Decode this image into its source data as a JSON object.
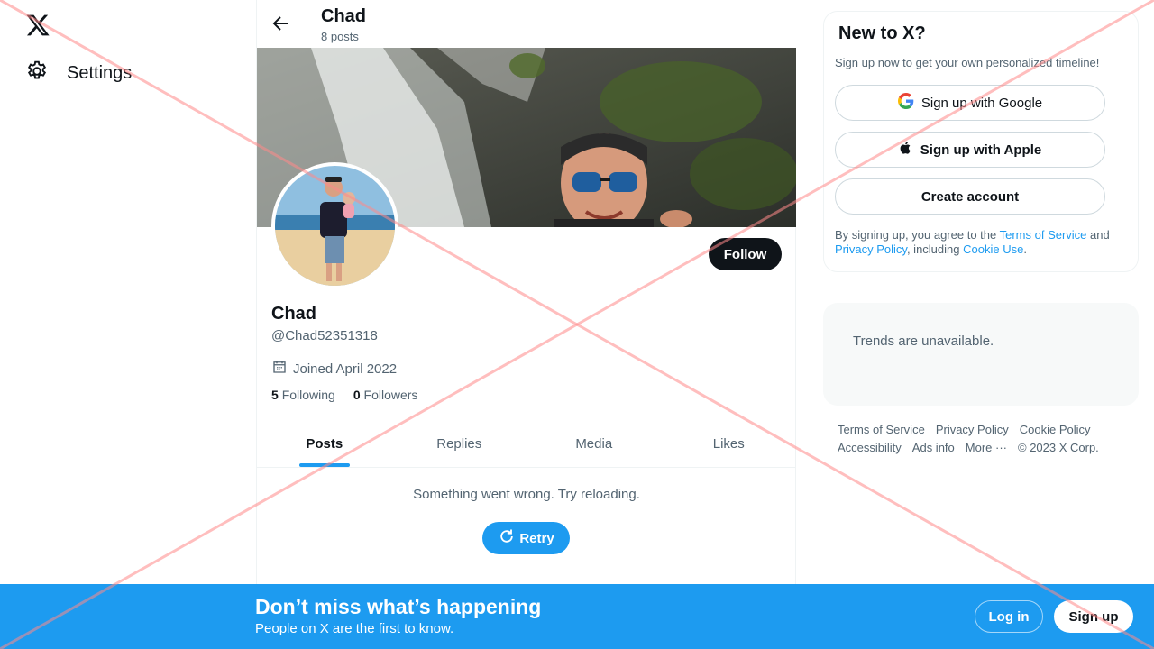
{
  "nav": {
    "logo_icon": "x-logo-icon",
    "settings_label": "Settings"
  },
  "header": {
    "name": "Chad",
    "posts_count": "8 posts"
  },
  "profile": {
    "name": "Chad",
    "handle": "@Chad52351318",
    "joined": "Joined April 2022",
    "following_count": "5",
    "following_label": "Following",
    "followers_count": "0",
    "followers_label": "Followers",
    "follow_label": "Follow"
  },
  "tabs": [
    {
      "label": "Posts",
      "active": true
    },
    {
      "label": "Replies",
      "active": false
    },
    {
      "label": "Media",
      "active": false
    },
    {
      "label": "Likes",
      "active": false
    }
  ],
  "feed": {
    "error_message": "Something went wrong. Try reloading.",
    "retry_label": "Retry"
  },
  "signup_card": {
    "title": "New to X?",
    "subtitle": "Sign up now to get your own personalized timeline!",
    "google_label": "Sign up with Google",
    "apple_label": "Sign up with Apple",
    "create_label": "Create account",
    "terms_prefix": "By signing up, you agree to the ",
    "terms_link": "Terms of Service",
    "terms_and": " and ",
    "privacy_link": "Privacy Policy",
    "terms_including": ", including ",
    "cookie_link": "Cookie Use",
    "terms_end": "."
  },
  "trends": {
    "message": "Trends are unavailable."
  },
  "footer": {
    "terms": "Terms of Service",
    "privacy": "Privacy Policy",
    "cookie": "Cookie Policy",
    "accessibility": "Accessibility",
    "ads": "Ads info",
    "more": "More ···",
    "copyright": "© 2023 X Corp."
  },
  "bottom_bar": {
    "title": "Don’t miss what’s happening",
    "subtitle": "People on X are the first to know.",
    "login_label": "Log in",
    "signup_label": "Sign up"
  },
  "colors": {
    "accent": "#1d9bf0",
    "text_primary": "#0f1419",
    "text_secondary": "#536471",
    "overlay_cross": "#ff8a8a"
  }
}
